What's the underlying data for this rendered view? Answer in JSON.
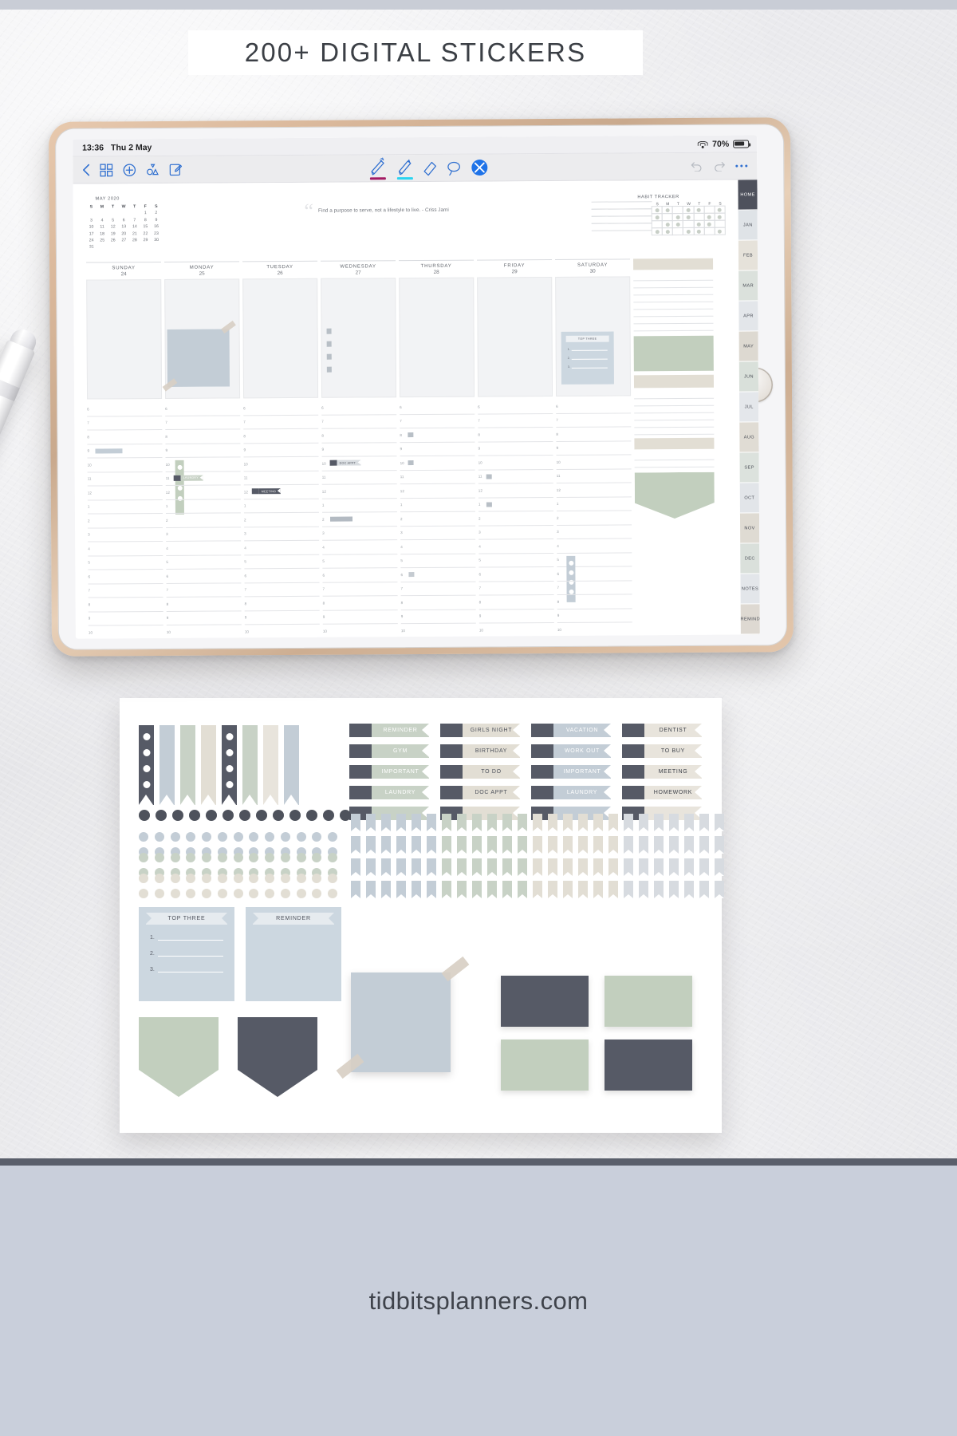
{
  "header": {
    "title": "200+ DIGITAL STICKERS"
  },
  "footer": {
    "website": "tidbitsplanners.com"
  },
  "device": {
    "status_bar": {
      "time": "13:36",
      "date": "Thu 2 May",
      "battery": "70%",
      "wifi_icon": "wifi-icon",
      "battery_icon": "battery-icon"
    },
    "toolbar": {
      "left_icons": [
        "back-chevron-icon",
        "grid-thumbnails-icon",
        "add-page-icon",
        "shapes-icon",
        "edit-note-icon"
      ],
      "tools": [
        {
          "name": "fountain-pen-tool",
          "underline_color": "#a31a63"
        },
        {
          "name": "highlighter-tool",
          "underline_color": "#2bd4f0"
        },
        {
          "name": "eraser-tool",
          "underline_color": ""
        },
        {
          "name": "lasso-select-tool",
          "underline_color": ""
        },
        {
          "name": "sticker-close-tool",
          "underline_color": ""
        }
      ],
      "right_icons": [
        "undo-icon",
        "redo-icon",
        "more-options-icon"
      ]
    }
  },
  "planner": {
    "mini_calendar": {
      "title": "MAY 2020",
      "weekday_headers": [
        "S",
        "M",
        "T",
        "W",
        "T",
        "F",
        "S"
      ],
      "weeks": [
        [
          "",
          "",
          "",
          "",
          "",
          "1",
          "2"
        ],
        [
          "3",
          "4",
          "5",
          "6",
          "7",
          "8",
          "9"
        ],
        [
          "10",
          "11",
          "12",
          "13",
          "14",
          "15",
          "16"
        ],
        [
          "17",
          "18",
          "19",
          "20",
          "21",
          "22",
          "23"
        ],
        [
          "24",
          "25",
          "26",
          "27",
          "28",
          "29",
          "30"
        ],
        [
          "31",
          "",
          "",
          "",
          "",
          "",
          ""
        ]
      ]
    },
    "quote": {
      "text": "Find a purpose to serve, not a lifestyle to live. - Criss Jami",
      "mark": "“"
    },
    "habit_tracker": {
      "title": "HABIT TRACKER",
      "day_headers": [
        "S",
        "M",
        "T",
        "W",
        "T",
        "F",
        "S"
      ],
      "row_count": 4
    },
    "days": [
      {
        "name": "SUNDAY",
        "number": "24"
      },
      {
        "name": "MONDAY",
        "number": "25"
      },
      {
        "name": "TUESDAY",
        "number": "26"
      },
      {
        "name": "WEDNESDAY",
        "number": "27"
      },
      {
        "name": "THURSDAY",
        "number": "28"
      },
      {
        "name": "FRIDAY",
        "number": "29"
      },
      {
        "name": "SATURDAY",
        "number": "30"
      }
    ],
    "hour_labels": [
      "6",
      "7",
      "8",
      "9",
      "10",
      "11",
      "12",
      "1",
      "2",
      "3",
      "4",
      "5",
      "6",
      "7",
      "8",
      "9",
      "10"
    ],
    "placed_stickers": [
      {
        "label": "LAUNDRY",
        "day": "MONDAY"
      },
      {
        "label": "DOC APPT",
        "day": "WEDNESDAY"
      },
      {
        "label": "MEETING",
        "day": "TUESDAY"
      },
      {
        "label": "TOP THREE",
        "day": "SATURDAY"
      }
    ],
    "top_three": {
      "title": "TOP THREE",
      "items": [
        "1.",
        "2.",
        "3."
      ]
    },
    "side_tabs": [
      "HOME",
      "JAN",
      "FEB",
      "MAR",
      "APR",
      "MAY",
      "JUN",
      "JUL",
      "AUG",
      "SEP",
      "OCT",
      "NOV",
      "DEC",
      "NOTES",
      "REMIND"
    ]
  },
  "sticker_sheet": {
    "label_columns": [
      {
        "text_color": "#ffffff",
        "bg": "#c8d2c6",
        "items": [
          "REMINDER",
          "GYM",
          "IMPORTANT",
          "LAUNDRY",
          ""
        ]
      },
      {
        "text_color": "#4e525c",
        "bg": "#e2ded4",
        "items": [
          "GIRLS NIGHT",
          "BIRTHDAY",
          "TO DO",
          "DOC APPT",
          ""
        ]
      },
      {
        "text_color": "#ffffff",
        "bg": "#c3cdd6",
        "items": [
          "VACATION",
          "WORK OUT",
          "IMPORTANT",
          "LAUNDRY",
          ""
        ]
      },
      {
        "text_color": "#3f434b",
        "bg": "#e8e4dc",
        "items": [
          "DENTIST",
          "TO BUY",
          "MEETING",
          "HOMEWORK",
          ""
        ]
      }
    ],
    "top_three_card": {
      "title": "TOP THREE",
      "items": [
        "1.",
        "2.",
        "3."
      ]
    },
    "reminder_card": {
      "title": "REMINDER"
    },
    "banner_colors": [
      "#565a66",
      "#c3cdd6",
      "#c8d2c6",
      "#e2ded4",
      "#565a66",
      "#c8d2c6",
      "#e8e4dc",
      "#c3cdd6"
    ],
    "dot_row_colors": [
      "#4e525c",
      "#c3cdd6",
      "#c8d2c6",
      "#e2ded4"
    ],
    "flag_colors": [
      "#c3cdd6",
      "#c8d2c6",
      "#e2ded4",
      "#d7dbe0"
    ],
    "shape_colors": {
      "sage": "#c2cfbe",
      "charcoal": "#565a66",
      "blue_grey": "#c3cdd6",
      "cream": "#e2ded4"
    }
  },
  "theme": {
    "accent_blue": "#2f6fd0",
    "charcoal": "#565a66",
    "sage": "#c2cfbe",
    "blue_grey": "#c3cdd6",
    "cream": "#e2ded4",
    "footer_bg": "#c9cfdb"
  }
}
